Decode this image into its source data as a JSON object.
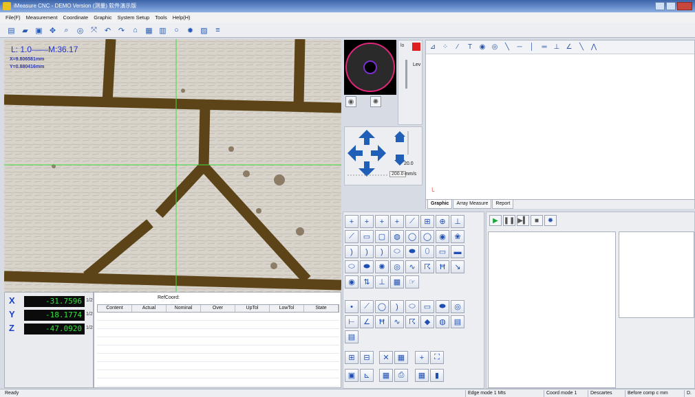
{
  "window": {
    "title": "iMeasure CNC - DEMO Version (测量) 软件演示版"
  },
  "menu": [
    "File(F)",
    "Measurement",
    "Coordinate",
    "Graphic",
    "System Setup",
    "Tools",
    "Help(H)"
  ],
  "toolbar": {
    "icons": [
      "new-file-icon",
      "open-folder-icon",
      "save-icon",
      "move-icon",
      "zoom-window-icon",
      "target-icon",
      "auto-trace-icon",
      "undo-icon",
      "redo-icon",
      "home-icon",
      "grid-icon",
      "table-icon",
      "circle-outline-icon",
      "gear-icon",
      "report-icon",
      "list-icon"
    ]
  },
  "camera": {
    "zoom_label": "L: 1.0——M:36.17",
    "x_label": "X=9.806581mm",
    "y_label": "Y=0.880416mm"
  },
  "dro": {
    "axes": [
      {
        "axis": "X",
        "value": "-31.7596",
        "half": "1/2"
      },
      {
        "axis": "Y",
        "value": "-18.1774",
        "half": "1/2"
      },
      {
        "axis": "Z",
        "value": "-47.0920",
        "half": "1/2"
      }
    ]
  },
  "results": {
    "ref_label": "RefCoord:",
    "columns": [
      "Content",
      "Actual",
      "Nominal",
      "Over",
      "UpTol",
      "LowTol",
      "State"
    ]
  },
  "light": {
    "led_label": "lo",
    "level_label": "Lev"
  },
  "jog": {
    "speed_value": "20.0",
    "speed_input": "200.0",
    "speed_unit": "mm/s"
  },
  "graphic": {
    "tabs": [
      "Graphic",
      "Array Measure",
      "Report"
    ]
  },
  "status": {
    "ready": "Ready",
    "edge_mode": "Edge mode 1 Mts",
    "coord_mode": "Coord mode 1",
    "descartes": "Descartes",
    "comp": "Before comp c mm",
    "d": "D."
  },
  "colors": {
    "dro_text": "#2fe63a",
    "axis_label": "#1a3fc8",
    "accent": "#2a52a8",
    "crosshair": "#3bdc3b",
    "preview_ring": "#e0267a"
  }
}
